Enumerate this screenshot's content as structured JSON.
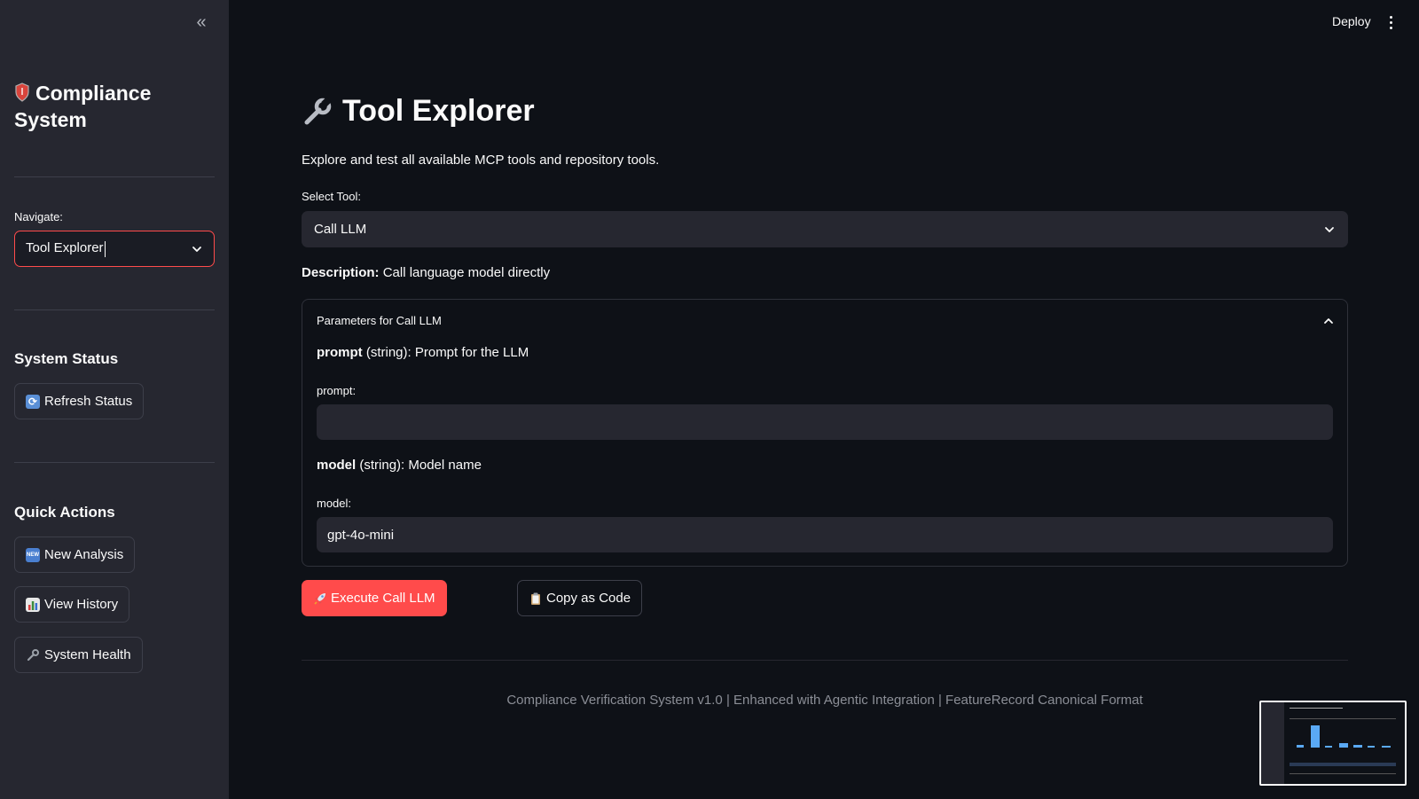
{
  "sidebar": {
    "title_line1": "Compliance",
    "title_line2": "System",
    "navigate_label": "Navigate:",
    "navigate_value": "Tool Explorer",
    "system_status_heading": "System Status",
    "refresh_status_label": "Refresh Status",
    "quick_actions_heading": "Quick Actions",
    "new_analysis_label": "New Analysis",
    "view_history_label": "View History",
    "system_health_label": "System Health"
  },
  "header": {
    "deploy_label": "Deploy"
  },
  "main": {
    "title": "Tool Explorer",
    "intro": "Explore and test all available MCP tools and repository tools.",
    "select_tool_label": "Select Tool:",
    "select_tool_value": "Call LLM",
    "description_label": "Description:",
    "description_text": "Call language model directly",
    "expander_title": "Parameters for Call LLM",
    "params": {
      "prompt_name": "prompt",
      "prompt_desc": "(string): Prompt for the LLM",
      "prompt_field_label": "prompt:",
      "prompt_value": "",
      "model_name": "model",
      "model_desc": "(string): Model name",
      "model_field_label": "model:",
      "model_value": "gpt-4o-mini"
    },
    "execute_label": "Execute Call LLM",
    "copy_label": "Copy as Code",
    "footer": "Compliance Verification System v1.0 | Enhanced with Agentic Integration | FeatureRecord Canonical Format"
  },
  "colors": {
    "background": "#0e1117",
    "sidebar": "#262730",
    "accent": "#ff4b4b",
    "text": "#fafafa"
  },
  "icons": {
    "collapse": "double-chevron-left-icon",
    "shield": "shield-icon",
    "refresh": "refresh-icon",
    "new": "new-badge-icon",
    "chart": "bar-chart-icon",
    "wrench": "wrench-icon",
    "rocket": "rocket-icon",
    "clipboard": "clipboard-icon"
  }
}
